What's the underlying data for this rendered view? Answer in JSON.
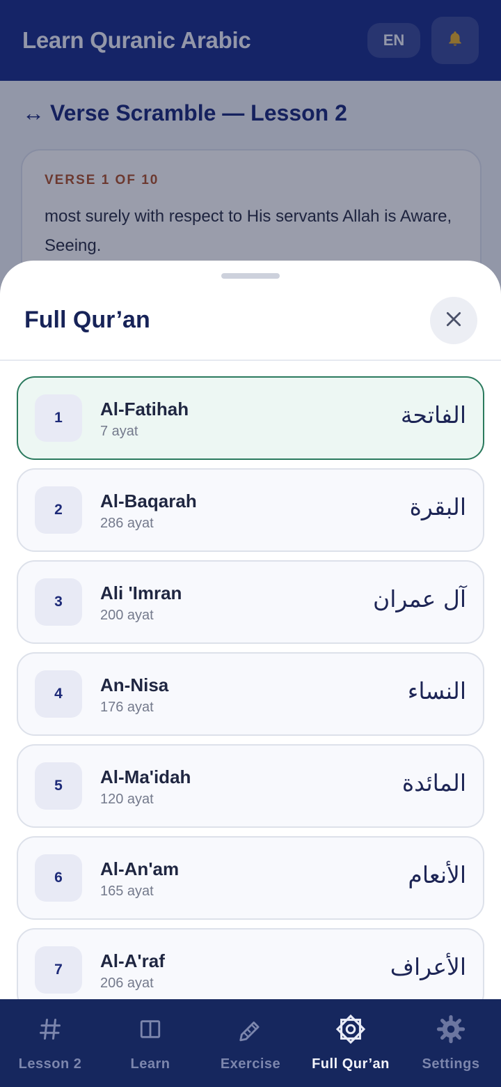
{
  "appbar": {
    "title": "Learn Quranic Arabic",
    "lang_label": "EN",
    "bell_icon": "bell-icon"
  },
  "exercise": {
    "icon": "↔",
    "title": "Verse Scramble — Lesson 2",
    "verse_counter": "VERSE 1 OF 10",
    "verse_text": "most surely with respect to His servants Allah is Aware, Seeing."
  },
  "sheet": {
    "title": "Full Qur’an",
    "close_icon": "close-icon",
    "surahs": [
      {
        "number": "1",
        "name": "Al-Fatihah",
        "ayat": "7 ayat",
        "arabic": "الفاتحة",
        "selected": true
      },
      {
        "number": "2",
        "name": "Al-Baqarah",
        "ayat": "286 ayat",
        "arabic": "البقرة",
        "selected": false
      },
      {
        "number": "3",
        "name": "Ali 'Imran",
        "ayat": "200 ayat",
        "arabic": "آل عمران",
        "selected": false
      },
      {
        "number": "4",
        "name": "An-Nisa",
        "ayat": "176 ayat",
        "arabic": "النساء",
        "selected": false
      },
      {
        "number": "5",
        "name": "Al-Ma'idah",
        "ayat": "120 ayat",
        "arabic": "المائدة",
        "selected": false
      },
      {
        "number": "6",
        "name": "Al-An'am",
        "ayat": "165 ayat",
        "arabic": "الأنعام",
        "selected": false
      },
      {
        "number": "7",
        "name": "Al-A'raf",
        "ayat": "206 ayat",
        "arabic": "الأعراف",
        "selected": false
      }
    ]
  },
  "nav": {
    "items": [
      {
        "label": "Lesson 2",
        "icon": "hash-icon",
        "active": false
      },
      {
        "label": "Learn",
        "icon": "book-icon",
        "active": false
      },
      {
        "label": "Exercise",
        "icon": "pencil-icon",
        "active": false
      },
      {
        "label": "Full Qur’an",
        "icon": "star-icon",
        "active": true
      },
      {
        "label": "Settings",
        "icon": "gear-icon",
        "active": false
      }
    ]
  },
  "colors": {
    "primary": "#1b2f8a",
    "nav_bg": "#16275e",
    "accent_orange": "#b0532c",
    "selected_border": "#2b7a5e",
    "selected_bg": "#edf7f3"
  }
}
